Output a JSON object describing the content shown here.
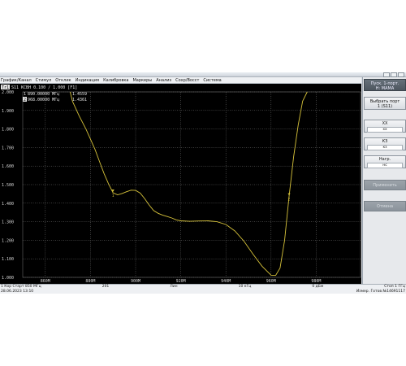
{
  "menu": [
    "График/Канал",
    "Стимул",
    "Отклик",
    "Индикация",
    "Калибровка",
    "Маркеры",
    "Анализ",
    "Сохр/Восст",
    "Система"
  ],
  "trace_header": {
    "trace_id": "Tr1",
    "text": "S11 КСВН 0.100 / 1.000 [F1]"
  },
  "markers": [
    {
      "id": "1",
      "freq": "890.00000 МГц",
      "value": "1.4559"
    },
    {
      "id": "2",
      "freq": "968.00000 МГц",
      "value": "1.4361"
    }
  ],
  "colors": {
    "trace": "#d6c23a",
    "grid": "#7a7a7a",
    "axis_text": "#d9d9d9",
    "marker_box": "#e6e6e6"
  },
  "chart_data": {
    "type": "line",
    "title": "",
    "ylabel": "",
    "xlabel": "",
    "y_unit_div": 0.1,
    "ylim": [
      1.0,
      2.0
    ],
    "xlim_mhz": [
      850,
      1000
    ],
    "y_tick_labels": [
      "2.000",
      "1.900",
      "1.800",
      "1.700",
      "1.600",
      "1.500",
      "1.400",
      "1.300",
      "1.200",
      "1.100",
      "1.000"
    ],
    "x_tick_labels": [
      "860М",
      "880М",
      "900М",
      "920М",
      "940М",
      "960М",
      "980М"
    ],
    "x_ticks_mhz": [
      860,
      880,
      900,
      920,
      940,
      960,
      980
    ],
    "series": [
      {
        "values_x_mhz": [
          871,
          872,
          875,
          878,
          880,
          882,
          884,
          886,
          888,
          890,
          892,
          894,
          896,
          898,
          900,
          902,
          904,
          906,
          908,
          910,
          912,
          914,
          916,
          918,
          920,
          924,
          928,
          932,
          936,
          940,
          944,
          948,
          952,
          956,
          960,
          962,
          964,
          966,
          968,
          970,
          972,
          974,
          976
        ],
        "values_y": [
          2.0,
          1.95,
          1.87,
          1.8,
          1.745,
          1.69,
          1.625,
          1.56,
          1.505,
          1.456,
          1.445,
          1.452,
          1.462,
          1.47,
          1.469,
          1.455,
          1.425,
          1.39,
          1.36,
          1.345,
          1.335,
          1.328,
          1.32,
          1.31,
          1.305,
          1.302,
          1.304,
          1.305,
          1.3,
          1.285,
          1.25,
          1.195,
          1.125,
          1.06,
          1.012,
          1.01,
          1.05,
          1.2,
          1.436,
          1.65,
          1.82,
          1.95,
          2.0
        ]
      }
    ],
    "markers_x_mhz": [
      890,
      968
    ],
    "markers_y": [
      1.4559,
      1.4361
    ]
  },
  "right_panel": {
    "top_button": {
      "line1": "Пуск. 1-порт.",
      "line2": "Н: МАМА"
    },
    "port_button": {
      "line1": "Выбрать порт",
      "line2": "1 (S11)"
    },
    "xx_button": {
      "label": "ХХ",
      "sub": "хх"
    },
    "kz_button": {
      "label": "КЗ",
      "sub": "кз"
    },
    "load_button": {
      "label": "Нагр.",
      "sub": "нс"
    },
    "apply_button": "Применить",
    "cancel_button": "Отмена"
  },
  "status_row1": {
    "left": "1  Кор Старт 850 МГц",
    "points": "201",
    "sweep": "Лин",
    "ifbw": "10 кГц",
    "power": "0 дБм",
    "stop": "Стоп 1 ГГц"
  },
  "status_row2": {
    "left": "28.06.2023 13:10",
    "right": "Измер. Готов №14691117"
  }
}
